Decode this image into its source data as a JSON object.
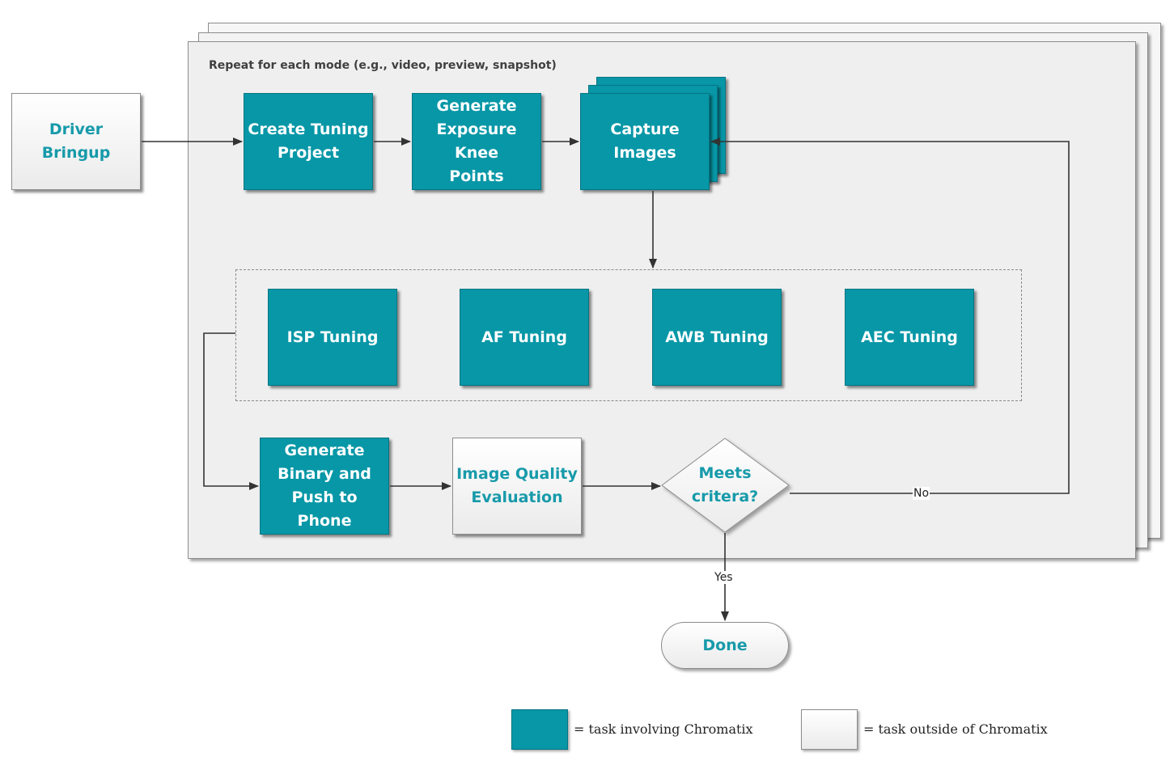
{
  "diagram": {
    "frame_caption": "Repeat for each mode (e.g., video, preview, snapshot)",
    "nodes": {
      "driver_bringup": "Driver Bringup",
      "create_tuning_project": "Create Tuning\nProject",
      "generate_exposure_knee_points": "Generate\nExposure Knee\nPoints",
      "capture_images": "Capture\nImages",
      "isp_tuning": "ISP Tuning",
      "af_tuning": "AF Tuning",
      "awb_tuning": "AWB Tuning",
      "aec_tuning": "AEC Tuning",
      "generate_binary": "Generate\nBinary and\nPush to Phone",
      "image_quality_evaluation": "Image Quality\nEvaluation",
      "meets_criteria": "Meets\ncritera?",
      "done": "Done"
    },
    "edge_labels": {
      "no": "No",
      "yes": "Yes"
    },
    "legend": {
      "chromatix": "= task involving Chromatix",
      "outside": "= task outside of Chromatix"
    },
    "colors": {
      "teal": "#0797a7",
      "teal_text": "#179aaa",
      "light": "#f2f2f2",
      "arrow": "#333333"
    }
  }
}
